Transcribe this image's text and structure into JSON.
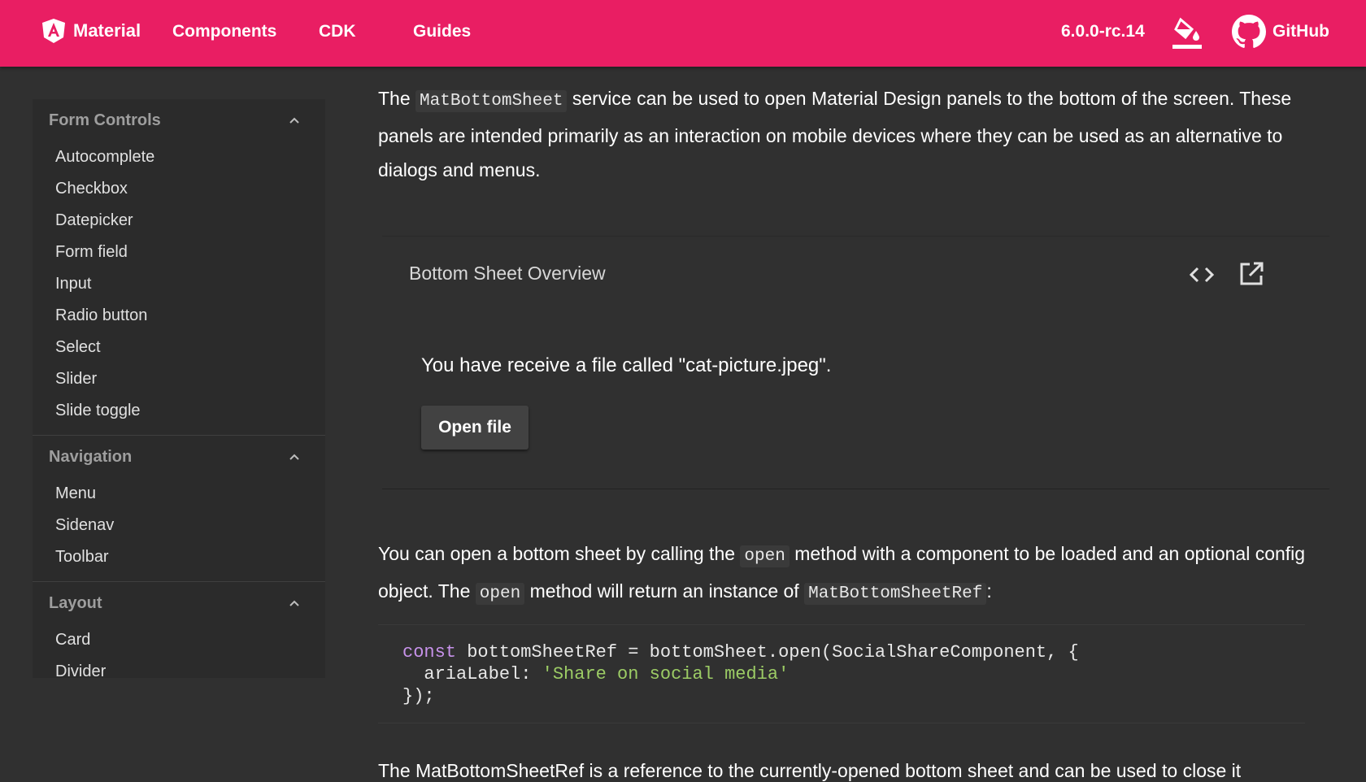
{
  "toolbar": {
    "brand": "Material",
    "nav": [
      "Components",
      "CDK",
      "Guides"
    ],
    "version": "6.0.0-rc.14",
    "github": "GitHub",
    "background": "#e91e63"
  },
  "sidebar": {
    "sections": [
      {
        "title": "Form Controls",
        "items": [
          "Autocomplete",
          "Checkbox",
          "Datepicker",
          "Form field",
          "Input",
          "Radio button",
          "Select",
          "Slider",
          "Slide toggle"
        ]
      },
      {
        "title": "Navigation",
        "items": [
          "Menu",
          "Sidenav",
          "Toolbar"
        ]
      },
      {
        "title": "Layout",
        "items": [
          "Card",
          "Divider"
        ]
      }
    ]
  },
  "intro": {
    "p1": "The ",
    "c1": "MatBottomSheet",
    "p2": " service can be used to open Material Design panels to the bottom of the screen. These panels are intended primarily as an interaction on mobile devices where they can be used as an alternative to dialogs and menus."
  },
  "example": {
    "title": "Bottom Sheet Overview",
    "text": "You have receive a file called \"cat-picture.jpeg\".",
    "button": "Open file",
    "icons": [
      "code-icon",
      "open-in-new-icon"
    ]
  },
  "usage": {
    "p1": "You can open a bottom sheet by calling the ",
    "c1": "open",
    "p2": " method with a component to be loaded and an optional config object. The ",
    "c2": "open",
    "p3": " method will return an instance of ",
    "c3": "MatBottomSheetRef",
    "p4": ":"
  },
  "code": {
    "line1_kw": "const",
    "line1_rest": " bottomSheetRef = bottomSheet.open(SocialShareComponent, {",
    "line2_key": "  ariaLabel: ",
    "line2_str": "'Share on social media'",
    "line3": "});"
  },
  "trailing": "The MatBottomSheetRef is a reference to the currently-opened bottom sheet and can be used to close it"
}
